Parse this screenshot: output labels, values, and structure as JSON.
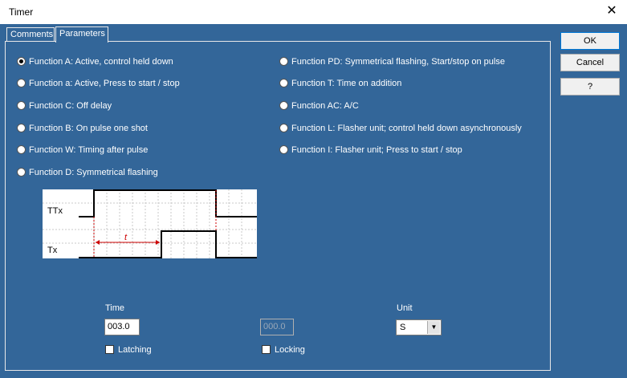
{
  "window": {
    "title": "Timer",
    "close_glyph": "✕"
  },
  "tabs": [
    {
      "label": "Comments"
    },
    {
      "label": "Parameters"
    }
  ],
  "functions_left": [
    {
      "label": "Function A: Active, control held down",
      "selected": true
    },
    {
      "label": "Function a: Active, Press to start / stop",
      "selected": false
    },
    {
      "label": "Function C: Off delay",
      "selected": false
    },
    {
      "label": "Function B: On pulse one shot",
      "selected": false
    },
    {
      "label": "Function W: Timing after pulse",
      "selected": false
    },
    {
      "label": "Function D: Symmetrical flashing",
      "selected": false
    }
  ],
  "functions_right": [
    {
      "label": "Function PD: Symmetrical flashing, Start/stop on pulse",
      "selected": false
    },
    {
      "label": "Function T: Time on addition",
      "selected": false
    },
    {
      "label": "Function AC: A/C",
      "selected": false
    },
    {
      "label": "Function L: Flasher unit; control held down asynchronously",
      "selected": false
    },
    {
      "label": "Function I: Flasher unit; Press to start / stop",
      "selected": false
    }
  ],
  "diagram": {
    "signal_top": "TTx",
    "signal_bottom": "Tx",
    "interval_label": "t",
    "accent": "#cc0000"
  },
  "time": {
    "label": "Time",
    "value": "003.0",
    "disabled_value": "000.0"
  },
  "unit": {
    "label": "Unit",
    "value": "S"
  },
  "options": {
    "latching": "Latching",
    "locking": "Locking"
  },
  "buttons": {
    "ok": "OK",
    "cancel": "Cancel",
    "help": "?"
  },
  "colors": {
    "panel_bg": "#336699",
    "text": "#ffffff"
  }
}
